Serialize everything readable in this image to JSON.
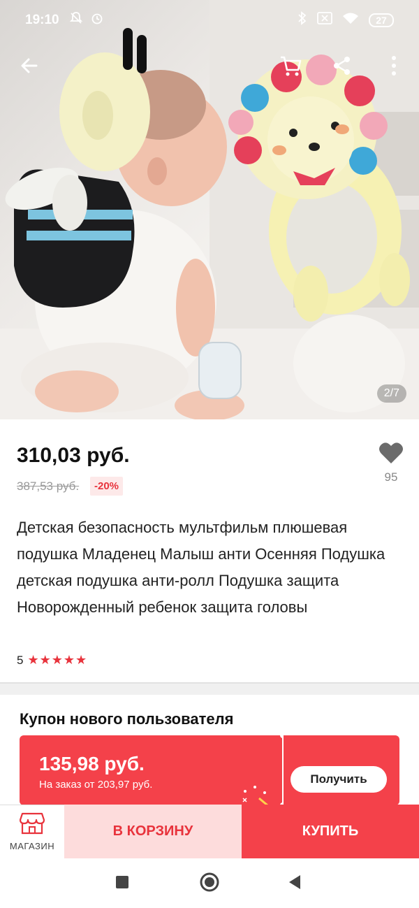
{
  "status_bar": {
    "time": "19:10",
    "battery": "27"
  },
  "gallery": {
    "counter": "2/7"
  },
  "product": {
    "price": "310,03 руб.",
    "old_price": "387,53 руб.",
    "discount": "-20%",
    "wishlist_count": "95",
    "title": "Детская безопасность мультфильм плюшевая подушка Младенец Малыш анти Осенняя Подушка детская подушка анти-ролл Подушка защита Новорожденный ребенок защита головы",
    "rating": "5",
    "stars": "★★★★★"
  },
  "coupon": {
    "title": "Купон нового пользователя",
    "amount": "135,98 руб.",
    "condition": "На заказ от 203,97 руб.",
    "get_label": "Получить"
  },
  "actions": {
    "shop_label": "МАГАЗИН",
    "cart_label": "В КОРЗИНУ",
    "buy_label": "КУПИТЬ"
  },
  "colors": {
    "accent": "#f4414a",
    "accent_light": "#fddcdc",
    "discount_bg": "#fde9e9"
  },
  "icons": [
    "back-arrow-icon",
    "cart-icon",
    "share-icon",
    "more-icon",
    "heart-icon",
    "store-icon",
    "nav-recents-icon",
    "nav-home-icon",
    "nav-back-icon"
  ]
}
